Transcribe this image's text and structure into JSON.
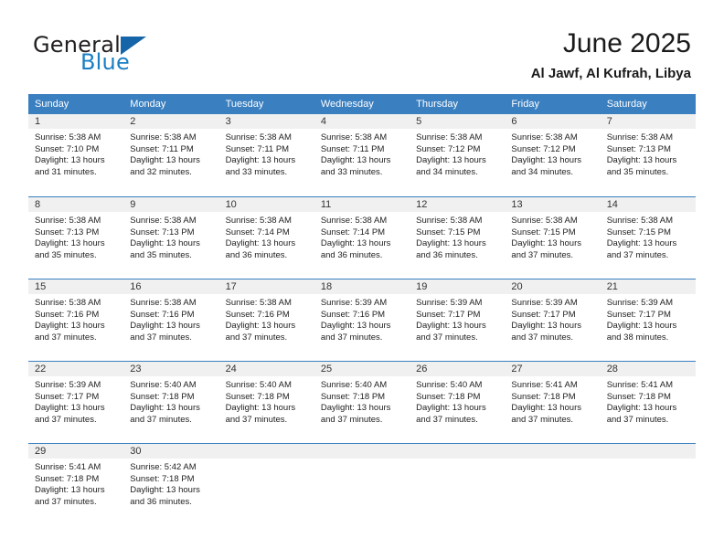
{
  "brand": {
    "line1": "General",
    "line2": "Blue",
    "triangle_icon": "blue-triangle-logo-mark",
    "colors": {
      "general": "#231f20",
      "blue": "#1b7fc3",
      "triangle": "#1565a8"
    }
  },
  "header": {
    "title": "June 2025",
    "subtitle": "Al Jawf, Al Kufrah, Libya"
  },
  "colors": {
    "header_row_bg": "#3a7fc0",
    "header_row_text": "#ffffff",
    "daynum_band_bg": "#f0f0f0",
    "week_divider": "#3a7fc0",
    "page_bg": "#ffffff"
  },
  "weekdays": [
    "Sunday",
    "Monday",
    "Tuesday",
    "Wednesday",
    "Thursday",
    "Friday",
    "Saturday"
  ],
  "labels": {
    "sunrise_prefix": "Sunrise:",
    "sunset_prefix": "Sunset:",
    "daylight_prefix": "Daylight:"
  },
  "chart_data": {
    "type": "table",
    "title": "June 2025",
    "subtitle": "Al Jawf, Al Kufrah, Libya",
    "columns": [
      "Sunday",
      "Monday",
      "Tuesday",
      "Wednesday",
      "Thursday",
      "Friday",
      "Saturday"
    ],
    "days": [
      {
        "day": 1,
        "weekday": "Sunday",
        "sunrise": "5:38 AM",
        "sunset": "7:10 PM",
        "daylight_hours": 13,
        "daylight_minutes": 31
      },
      {
        "day": 2,
        "weekday": "Monday",
        "sunrise": "5:38 AM",
        "sunset": "7:11 PM",
        "daylight_hours": 13,
        "daylight_minutes": 32
      },
      {
        "day": 3,
        "weekday": "Tuesday",
        "sunrise": "5:38 AM",
        "sunset": "7:11 PM",
        "daylight_hours": 13,
        "daylight_minutes": 33
      },
      {
        "day": 4,
        "weekday": "Wednesday",
        "sunrise": "5:38 AM",
        "sunset": "7:11 PM",
        "daylight_hours": 13,
        "daylight_minutes": 33
      },
      {
        "day": 5,
        "weekday": "Thursday",
        "sunrise": "5:38 AM",
        "sunset": "7:12 PM",
        "daylight_hours": 13,
        "daylight_minutes": 34
      },
      {
        "day": 6,
        "weekday": "Friday",
        "sunrise": "5:38 AM",
        "sunset": "7:12 PM",
        "daylight_hours": 13,
        "daylight_minutes": 34
      },
      {
        "day": 7,
        "weekday": "Saturday",
        "sunrise": "5:38 AM",
        "sunset": "7:13 PM",
        "daylight_hours": 13,
        "daylight_minutes": 35
      },
      {
        "day": 8,
        "weekday": "Sunday",
        "sunrise": "5:38 AM",
        "sunset": "7:13 PM",
        "daylight_hours": 13,
        "daylight_minutes": 35
      },
      {
        "day": 9,
        "weekday": "Monday",
        "sunrise": "5:38 AM",
        "sunset": "7:13 PM",
        "daylight_hours": 13,
        "daylight_minutes": 35
      },
      {
        "day": 10,
        "weekday": "Tuesday",
        "sunrise": "5:38 AM",
        "sunset": "7:14 PM",
        "daylight_hours": 13,
        "daylight_minutes": 36
      },
      {
        "day": 11,
        "weekday": "Wednesday",
        "sunrise": "5:38 AM",
        "sunset": "7:14 PM",
        "daylight_hours": 13,
        "daylight_minutes": 36
      },
      {
        "day": 12,
        "weekday": "Thursday",
        "sunrise": "5:38 AM",
        "sunset": "7:15 PM",
        "daylight_hours": 13,
        "daylight_minutes": 36
      },
      {
        "day": 13,
        "weekday": "Friday",
        "sunrise": "5:38 AM",
        "sunset": "7:15 PM",
        "daylight_hours": 13,
        "daylight_minutes": 37
      },
      {
        "day": 14,
        "weekday": "Saturday",
        "sunrise": "5:38 AM",
        "sunset": "7:15 PM",
        "daylight_hours": 13,
        "daylight_minutes": 37
      },
      {
        "day": 15,
        "weekday": "Sunday",
        "sunrise": "5:38 AM",
        "sunset": "7:16 PM",
        "daylight_hours": 13,
        "daylight_minutes": 37
      },
      {
        "day": 16,
        "weekday": "Monday",
        "sunrise": "5:38 AM",
        "sunset": "7:16 PM",
        "daylight_hours": 13,
        "daylight_minutes": 37
      },
      {
        "day": 17,
        "weekday": "Tuesday",
        "sunrise": "5:38 AM",
        "sunset": "7:16 PM",
        "daylight_hours": 13,
        "daylight_minutes": 37
      },
      {
        "day": 18,
        "weekday": "Wednesday",
        "sunrise": "5:39 AM",
        "sunset": "7:16 PM",
        "daylight_hours": 13,
        "daylight_minutes": 37
      },
      {
        "day": 19,
        "weekday": "Thursday",
        "sunrise": "5:39 AM",
        "sunset": "7:17 PM",
        "daylight_hours": 13,
        "daylight_minutes": 37
      },
      {
        "day": 20,
        "weekday": "Friday",
        "sunrise": "5:39 AM",
        "sunset": "7:17 PM",
        "daylight_hours": 13,
        "daylight_minutes": 37
      },
      {
        "day": 21,
        "weekday": "Saturday",
        "sunrise": "5:39 AM",
        "sunset": "7:17 PM",
        "daylight_hours": 13,
        "daylight_minutes": 38
      },
      {
        "day": 22,
        "weekday": "Sunday",
        "sunrise": "5:39 AM",
        "sunset": "7:17 PM",
        "daylight_hours": 13,
        "daylight_minutes": 37
      },
      {
        "day": 23,
        "weekday": "Monday",
        "sunrise": "5:40 AM",
        "sunset": "7:18 PM",
        "daylight_hours": 13,
        "daylight_minutes": 37
      },
      {
        "day": 24,
        "weekday": "Tuesday",
        "sunrise": "5:40 AM",
        "sunset": "7:18 PM",
        "daylight_hours": 13,
        "daylight_minutes": 37
      },
      {
        "day": 25,
        "weekday": "Wednesday",
        "sunrise": "5:40 AM",
        "sunset": "7:18 PM",
        "daylight_hours": 13,
        "daylight_minutes": 37
      },
      {
        "day": 26,
        "weekday": "Thursday",
        "sunrise": "5:40 AM",
        "sunset": "7:18 PM",
        "daylight_hours": 13,
        "daylight_minutes": 37
      },
      {
        "day": 27,
        "weekday": "Friday",
        "sunrise": "5:41 AM",
        "sunset": "7:18 PM",
        "daylight_hours": 13,
        "daylight_minutes": 37
      },
      {
        "day": 28,
        "weekday": "Saturday",
        "sunrise": "5:41 AM",
        "sunset": "7:18 PM",
        "daylight_hours": 13,
        "daylight_minutes": 37
      },
      {
        "day": 29,
        "weekday": "Sunday",
        "sunrise": "5:41 AM",
        "sunset": "7:18 PM",
        "daylight_hours": 13,
        "daylight_minutes": 37
      },
      {
        "day": 30,
        "weekday": "Monday",
        "sunrise": "5:42 AM",
        "sunset": "7:18 PM",
        "daylight_hours": 13,
        "daylight_minutes": 36
      }
    ],
    "leading_blanks": 0,
    "trailing_blanks": 5
  }
}
